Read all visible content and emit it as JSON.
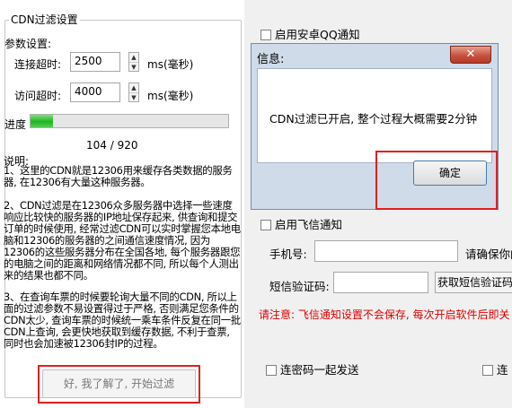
{
  "left": {
    "group_title": "CDN过滤设置",
    "params_label": "参数设置:",
    "connect_timeout": {
      "label": "连接超时:",
      "value": "2500",
      "unit": "ms(毫秒)"
    },
    "access_timeout": {
      "label": "访问超时:",
      "value": "4000",
      "unit": "ms(毫秒)"
    },
    "progress": {
      "label": "进度",
      "current": 104,
      "total": 920,
      "fraction": 0.113,
      "text": "104 / 920"
    },
    "desc_title": "说明:",
    "desc_1": "    1、这里的CDN就是12306用来缓存各类数据的服务器, 在12306有大量这种服务器。",
    "desc_2": "    2、CDN过滤是在12306众多服务器中选择一些速度响应比较快的服务器的IP地址保存起来, 供查询和提交订单的时候使用, 经常过滤CDN可以实时掌握您本地电脑和12306的服务器的之间通信速度情况, 因为12306的这些服务器分布在全国各地, 每个服务器跟您的电脑之间的距离和网络情况都不同, 所以每个人测出来的结果也都不同。",
    "desc_3": "    3、在查询车票的时候要轮询大量不同的CDN, 所以上面的过滤参数不易设置得过于严格, 否则满足您条件的CDN太少, 查询车票的时候统一乘车条件反复在同一批CDN上查询, 会更快地获取到缓存数据, 不利于查票, 同时也会加速被12306封IP的过程。",
    "start_button": "好, 我了解了, 开始过滤"
  },
  "right": {
    "android_qq": "启用安卓QQ通知",
    "feixin": "启用飞信通知",
    "phone_label": "手机号:",
    "phone_hint": "请确保你的",
    "sms_label": "短信验证码:",
    "sms_button": "获取短信验证码",
    "warning": "请注意: 飞信通知设置不会保存, 每次开启软件后即关",
    "captcha_send": "连密码一起发送",
    "edge_partial": "连"
  },
  "dialog": {
    "title": "信息:",
    "close_glyph": "✕",
    "message": "CDN过滤已开启, 整个过程大概需要2分钟",
    "ok_button": "确定"
  },
  "colors": {
    "highlight": "#e02020",
    "progress": "#1fb61f",
    "warning_text": "#e00000"
  }
}
